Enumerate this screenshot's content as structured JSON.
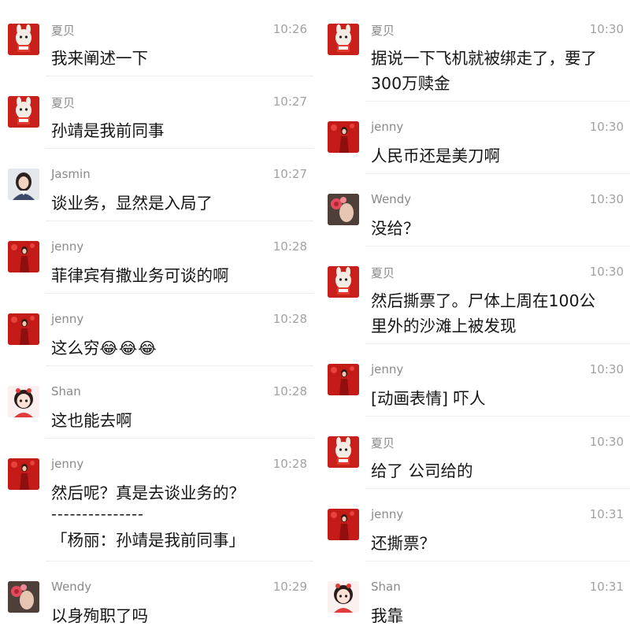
{
  "left_messages": [
    {
      "sender": "夏贝",
      "time": "10:26",
      "text": "我来阐述一下",
      "avatar": "rabbit-doll-red"
    },
    {
      "sender": "夏贝",
      "time": "10:27",
      "text": "孙靖是我前同事",
      "avatar": "rabbit-doll-red"
    },
    {
      "sender": "Jasmin",
      "time": "10:27",
      "text": "谈业务，显然是入局了",
      "avatar": "woman-portrait"
    },
    {
      "sender": "jenny",
      "time": "10:28",
      "text": "菲律宾有撒业务可谈的啊",
      "avatar": "woman-in-red"
    },
    {
      "sender": "jenny",
      "time": "10:28",
      "text": "这么穷",
      "emoji": "😂😂😂",
      "avatar": "woman-in-red"
    },
    {
      "sender": "Shan",
      "time": "10:28",
      "text": "这也能去啊",
      "avatar": "cartoon-girl"
    },
    {
      "sender": "jenny",
      "time": "10:28",
      "text": "然后呢？真是去谈业务的？",
      "dashes": "---------------",
      "quote": "「杨丽：孙靖是我前同事」",
      "avatar": "woman-in-red"
    },
    {
      "sender": "Wendy",
      "time": "10:29",
      "text": "以身殉职了吗",
      "avatar": "flower-woman"
    }
  ],
  "right_messages": [
    {
      "sender": "夏贝",
      "time": "10:30",
      "text": "据说一下飞机就被绑走了，要了\n300万赎金",
      "avatar": "rabbit-doll-red"
    },
    {
      "sender": "jenny",
      "time": "10:30",
      "text": "人民币还是美刀啊",
      "avatar": "woman-in-red"
    },
    {
      "sender": "Wendy",
      "time": "10:30",
      "text": "没给？",
      "avatar": "flower-woman"
    },
    {
      "sender": "夏贝",
      "time": "10:30",
      "text": "然后撕票了。尸体上周在100公\n里外的沙滩上被发现",
      "avatar": "rabbit-doll-red"
    },
    {
      "sender": "jenny",
      "time": "10:30",
      "text": "[动画表情] 吓人",
      "avatar": "woman-in-red"
    },
    {
      "sender": "夏贝",
      "time": "10:30",
      "text": "给了 公司给的",
      "avatar": "rabbit-doll-red"
    },
    {
      "sender": "jenny",
      "time": "10:31",
      "text": "还撕票？",
      "avatar": "woman-in-red"
    },
    {
      "sender": "Shan",
      "time": "10:31",
      "text": "我靠",
      "avatar": "cartoon-girl"
    }
  ]
}
